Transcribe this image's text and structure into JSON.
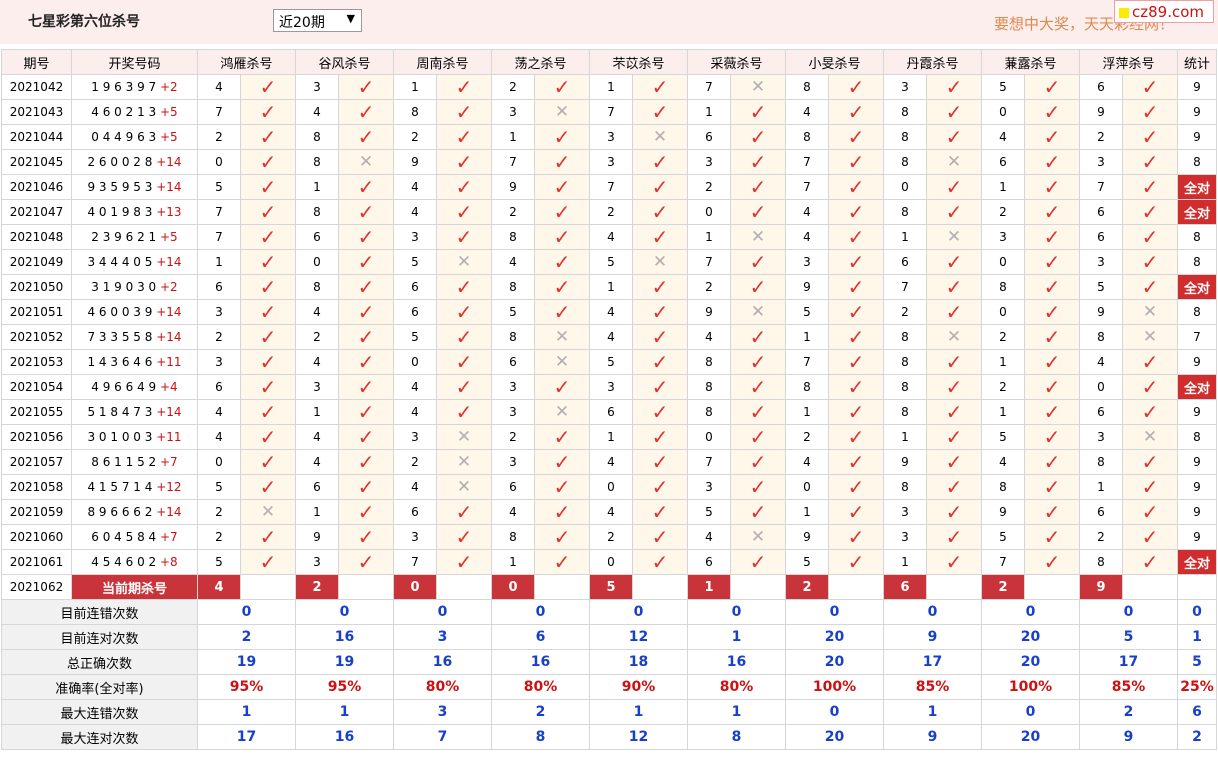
{
  "header": {
    "title": "七星彩第六位杀号",
    "select_value": "近20期",
    "slogan": "要想中大奖，天天彩经网！",
    "logo_text": "cz89.com"
  },
  "columns": {
    "period": "期号",
    "draw": "开奖号码",
    "experts": [
      "鸿雁杀号",
      "谷风杀号",
      "周南杀号",
      "荡之杀号",
      "芣苡杀号",
      "采薇杀号",
      "小旻杀号",
      "丹霞杀号",
      "蒹露杀号",
      "浮萍杀号"
    ],
    "stat": "统计"
  },
  "icons": {
    "hit": "check-icon",
    "miss": "cross-icon"
  },
  "rows": [
    {
      "period": "2021042",
      "digits": "1 9 6 3 9 7",
      "bonus": "+2",
      "picks": [
        [
          4,
          1
        ],
        [
          3,
          1
        ],
        [
          1,
          1
        ],
        [
          2,
          1
        ],
        [
          1,
          1
        ],
        [
          7,
          0
        ],
        [
          8,
          1
        ],
        [
          3,
          1
        ],
        [
          5,
          1
        ],
        [
          6,
          1
        ]
      ],
      "stat": "9"
    },
    {
      "period": "2021043",
      "digits": "4 6 0 2 1 3",
      "bonus": "+5",
      "picks": [
        [
          7,
          1
        ],
        [
          4,
          1
        ],
        [
          8,
          1
        ],
        [
          3,
          0
        ],
        [
          7,
          1
        ],
        [
          1,
          1
        ],
        [
          4,
          1
        ],
        [
          8,
          1
        ],
        [
          0,
          1
        ],
        [
          9,
          1
        ]
      ],
      "stat": "9"
    },
    {
      "period": "2021044",
      "digits": "0 4 4 9 6 3",
      "bonus": "+5",
      "picks": [
        [
          2,
          1
        ],
        [
          8,
          1
        ],
        [
          2,
          1
        ],
        [
          1,
          1
        ],
        [
          3,
          0
        ],
        [
          6,
          1
        ],
        [
          8,
          1
        ],
        [
          8,
          1
        ],
        [
          4,
          1
        ],
        [
          2,
          1
        ]
      ],
      "stat": "9"
    },
    {
      "period": "2021045",
      "digits": "2 6 0 0 2 8",
      "bonus": "+14",
      "picks": [
        [
          0,
          1
        ],
        [
          8,
          0
        ],
        [
          9,
          1
        ],
        [
          7,
          1
        ],
        [
          3,
          1
        ],
        [
          3,
          1
        ],
        [
          7,
          1
        ],
        [
          8,
          0
        ],
        [
          6,
          1
        ],
        [
          3,
          1
        ]
      ],
      "stat": "8"
    },
    {
      "period": "2021046",
      "digits": "9 3 5 9 5 3",
      "bonus": "+14",
      "picks": [
        [
          5,
          1
        ],
        [
          1,
          1
        ],
        [
          4,
          1
        ],
        [
          9,
          1
        ],
        [
          7,
          1
        ],
        [
          2,
          1
        ],
        [
          7,
          1
        ],
        [
          0,
          1
        ],
        [
          1,
          1
        ],
        [
          7,
          1
        ]
      ],
      "stat": "全对"
    },
    {
      "period": "2021047",
      "digits": "4 0 1 9 8 3",
      "bonus": "+13",
      "picks": [
        [
          7,
          1
        ],
        [
          8,
          1
        ],
        [
          4,
          1
        ],
        [
          2,
          1
        ],
        [
          2,
          1
        ],
        [
          0,
          1
        ],
        [
          4,
          1
        ],
        [
          8,
          1
        ],
        [
          2,
          1
        ],
        [
          6,
          1
        ]
      ],
      "stat": "全对"
    },
    {
      "period": "2021048",
      "digits": "2 3 9 6 2 1",
      "bonus": "+5",
      "picks": [
        [
          7,
          1
        ],
        [
          6,
          1
        ],
        [
          3,
          1
        ],
        [
          8,
          1
        ],
        [
          4,
          1
        ],
        [
          1,
          0
        ],
        [
          4,
          1
        ],
        [
          1,
          0
        ],
        [
          3,
          1
        ],
        [
          6,
          1
        ]
      ],
      "stat": "8"
    },
    {
      "period": "2021049",
      "digits": "3 4 4 4 0 5",
      "bonus": "+14",
      "picks": [
        [
          1,
          1
        ],
        [
          0,
          1
        ],
        [
          5,
          0
        ],
        [
          4,
          1
        ],
        [
          5,
          0
        ],
        [
          7,
          1
        ],
        [
          3,
          1
        ],
        [
          6,
          1
        ],
        [
          0,
          1
        ],
        [
          3,
          1
        ]
      ],
      "stat": "8"
    },
    {
      "period": "2021050",
      "digits": "3 1 9 0 3 0",
      "bonus": "+2",
      "picks": [
        [
          6,
          1
        ],
        [
          8,
          1
        ],
        [
          6,
          1
        ],
        [
          8,
          1
        ],
        [
          1,
          1
        ],
        [
          2,
          1
        ],
        [
          9,
          1
        ],
        [
          7,
          1
        ],
        [
          8,
          1
        ],
        [
          5,
          1
        ]
      ],
      "stat": "全对"
    },
    {
      "period": "2021051",
      "digits": "4 6 0 0 3 9",
      "bonus": "+14",
      "picks": [
        [
          3,
          1
        ],
        [
          4,
          1
        ],
        [
          6,
          1
        ],
        [
          5,
          1
        ],
        [
          4,
          1
        ],
        [
          9,
          0
        ],
        [
          5,
          1
        ],
        [
          2,
          1
        ],
        [
          0,
          1
        ],
        [
          9,
          0
        ]
      ],
      "stat": "8"
    },
    {
      "period": "2021052",
      "digits": "7 3 3 5 5 8",
      "bonus": "+14",
      "picks": [
        [
          2,
          1
        ],
        [
          2,
          1
        ],
        [
          5,
          1
        ],
        [
          8,
          0
        ],
        [
          4,
          1
        ],
        [
          4,
          1
        ],
        [
          1,
          1
        ],
        [
          8,
          0
        ],
        [
          2,
          1
        ],
        [
          8,
          0
        ]
      ],
      "stat": "7"
    },
    {
      "period": "2021053",
      "digits": "1 4 3 6 4 6",
      "bonus": "+11",
      "picks": [
        [
          3,
          1
        ],
        [
          4,
          1
        ],
        [
          0,
          1
        ],
        [
          6,
          0
        ],
        [
          5,
          1
        ],
        [
          8,
          1
        ],
        [
          7,
          1
        ],
        [
          8,
          1
        ],
        [
          1,
          1
        ],
        [
          4,
          1
        ]
      ],
      "stat": "9"
    },
    {
      "period": "2021054",
      "digits": "4 9 6 6 4 9",
      "bonus": "+4",
      "picks": [
        [
          6,
          1
        ],
        [
          3,
          1
        ],
        [
          4,
          1
        ],
        [
          3,
          1
        ],
        [
          3,
          1
        ],
        [
          8,
          1
        ],
        [
          8,
          1
        ],
        [
          8,
          1
        ],
        [
          2,
          1
        ],
        [
          0,
          1
        ]
      ],
      "stat": "全对"
    },
    {
      "period": "2021055",
      "digits": "5 1 8 4 7 3",
      "bonus": "+14",
      "picks": [
        [
          4,
          1
        ],
        [
          1,
          1
        ],
        [
          4,
          1
        ],
        [
          3,
          0
        ],
        [
          6,
          1
        ],
        [
          8,
          1
        ],
        [
          1,
          1
        ],
        [
          8,
          1
        ],
        [
          1,
          1
        ],
        [
          6,
          1
        ]
      ],
      "stat": "9"
    },
    {
      "period": "2021056",
      "digits": "3 0 1 0 0 3",
      "bonus": "+11",
      "picks": [
        [
          4,
          1
        ],
        [
          4,
          1
        ],
        [
          3,
          0
        ],
        [
          2,
          1
        ],
        [
          1,
          1
        ],
        [
          0,
          1
        ],
        [
          2,
          1
        ],
        [
          1,
          1
        ],
        [
          5,
          1
        ],
        [
          3,
          0
        ]
      ],
      "stat": "8"
    },
    {
      "period": "2021057",
      "digits": "8 6 1 1 5 2",
      "bonus": "+7",
      "picks": [
        [
          0,
          1
        ],
        [
          4,
          1
        ],
        [
          2,
          0
        ],
        [
          3,
          1
        ],
        [
          4,
          1
        ],
        [
          7,
          1
        ],
        [
          4,
          1
        ],
        [
          9,
          1
        ],
        [
          4,
          1
        ],
        [
          8,
          1
        ]
      ],
      "stat": "9"
    },
    {
      "period": "2021058",
      "digits": "4 1 5 7 1 4",
      "bonus": "+12",
      "picks": [
        [
          5,
          1
        ],
        [
          6,
          1
        ],
        [
          4,
          0
        ],
        [
          6,
          1
        ],
        [
          0,
          1
        ],
        [
          3,
          1
        ],
        [
          0,
          1
        ],
        [
          8,
          1
        ],
        [
          8,
          1
        ],
        [
          1,
          1
        ]
      ],
      "stat": "9"
    },
    {
      "period": "2021059",
      "digits": "8 9 6 6 6 2",
      "bonus": "+14",
      "picks": [
        [
          2,
          0
        ],
        [
          1,
          1
        ],
        [
          6,
          1
        ],
        [
          4,
          1
        ],
        [
          4,
          1
        ],
        [
          5,
          1
        ],
        [
          1,
          1
        ],
        [
          3,
          1
        ],
        [
          9,
          1
        ],
        [
          6,
          1
        ]
      ],
      "stat": "9"
    },
    {
      "period": "2021060",
      "digits": "6 0 4 5 8 4",
      "bonus": "+7",
      "picks": [
        [
          2,
          1
        ],
        [
          9,
          1
        ],
        [
          3,
          1
        ],
        [
          8,
          1
        ],
        [
          2,
          1
        ],
        [
          4,
          0
        ],
        [
          9,
          1
        ],
        [
          3,
          1
        ],
        [
          5,
          1
        ],
        [
          2,
          1
        ]
      ],
      "stat": "9"
    },
    {
      "period": "2021061",
      "digits": "4 5 4 6 0 2",
      "bonus": "+8",
      "picks": [
        [
          5,
          1
        ],
        [
          3,
          1
        ],
        [
          7,
          1
        ],
        [
          1,
          1
        ],
        [
          0,
          1
        ],
        [
          6,
          1
        ],
        [
          5,
          1
        ],
        [
          1,
          1
        ],
        [
          7,
          1
        ],
        [
          8,
          1
        ]
      ],
      "stat": "全对"
    }
  ],
  "current": {
    "period": "2021062",
    "label": "当前期杀号",
    "picks": [
      "4",
      "2",
      "0",
      "0",
      "5",
      "1",
      "2",
      "6",
      "2",
      "9"
    ]
  },
  "summary": [
    {
      "label": "目前连错次数",
      "values": [
        "0",
        "0",
        "0",
        "0",
        "0",
        "0",
        "0",
        "0",
        "0",
        "0",
        "0"
      ],
      "style": "blue"
    },
    {
      "label": "目前连对次数",
      "values": [
        "2",
        "16",
        "3",
        "6",
        "12",
        "1",
        "20",
        "9",
        "20",
        "5",
        "1"
      ],
      "style": "blue"
    },
    {
      "label": "总正确次数",
      "values": [
        "19",
        "19",
        "16",
        "16",
        "18",
        "16",
        "20",
        "17",
        "20",
        "17",
        "5"
      ],
      "style": "blue"
    },
    {
      "label": "准确率(全对率)",
      "values": [
        "95%",
        "95%",
        "80%",
        "80%",
        "90%",
        "80%",
        "100%",
        "85%",
        "100%",
        "85%",
        "25%"
      ],
      "style": "red"
    },
    {
      "label": "最大连错次数",
      "values": [
        "1",
        "1",
        "3",
        "2",
        "1",
        "1",
        "0",
        "1",
        "0",
        "2",
        "6"
      ],
      "style": "blue"
    },
    {
      "label": "最大连对次数",
      "values": [
        "17",
        "16",
        "7",
        "8",
        "12",
        "8",
        "20",
        "9",
        "20",
        "9",
        "2"
      ],
      "style": "blue"
    }
  ]
}
